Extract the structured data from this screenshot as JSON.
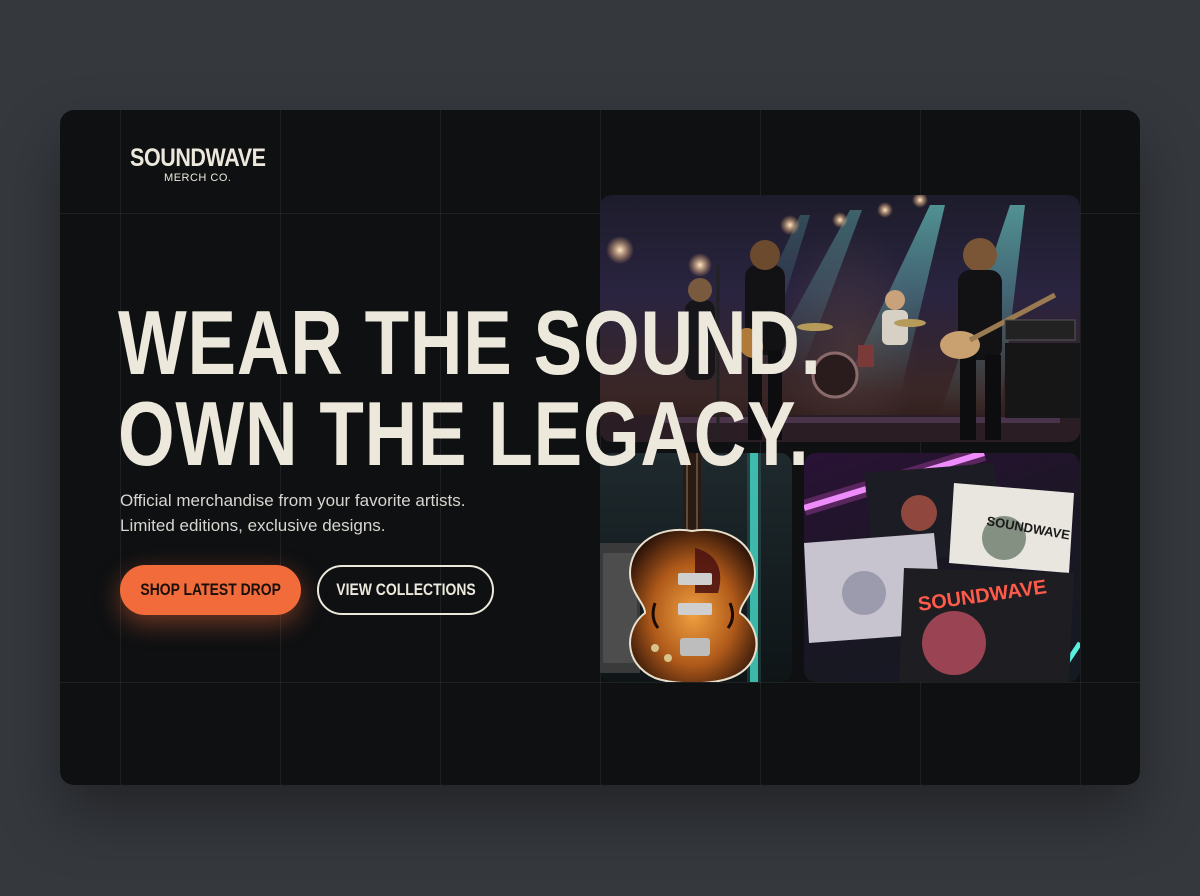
{
  "brand": {
    "name": "SOUNDWAVE",
    "subtitle": "MERCH CO."
  },
  "hero": {
    "headline_line1": "WEAR THE SOUND.",
    "headline_line2": "OWN THE LEGACY.",
    "description_line1": "Official merchandise from your favorite artists.",
    "description_line2": "Limited editions, exclusive designs."
  },
  "actions": {
    "primary_label": "SHOP LATEST DROP",
    "secondary_label": "VIEW COLLECTIONS"
  },
  "gallery": {
    "shirt_print_1": "SOUNDWAVE",
    "shirt_print_2": "SOUNDWAVE"
  },
  "colors": {
    "accent": "#f26b3a",
    "text": "#ece8dc",
    "card_bg": "#0e1012",
    "page_bg": "#35383d"
  }
}
